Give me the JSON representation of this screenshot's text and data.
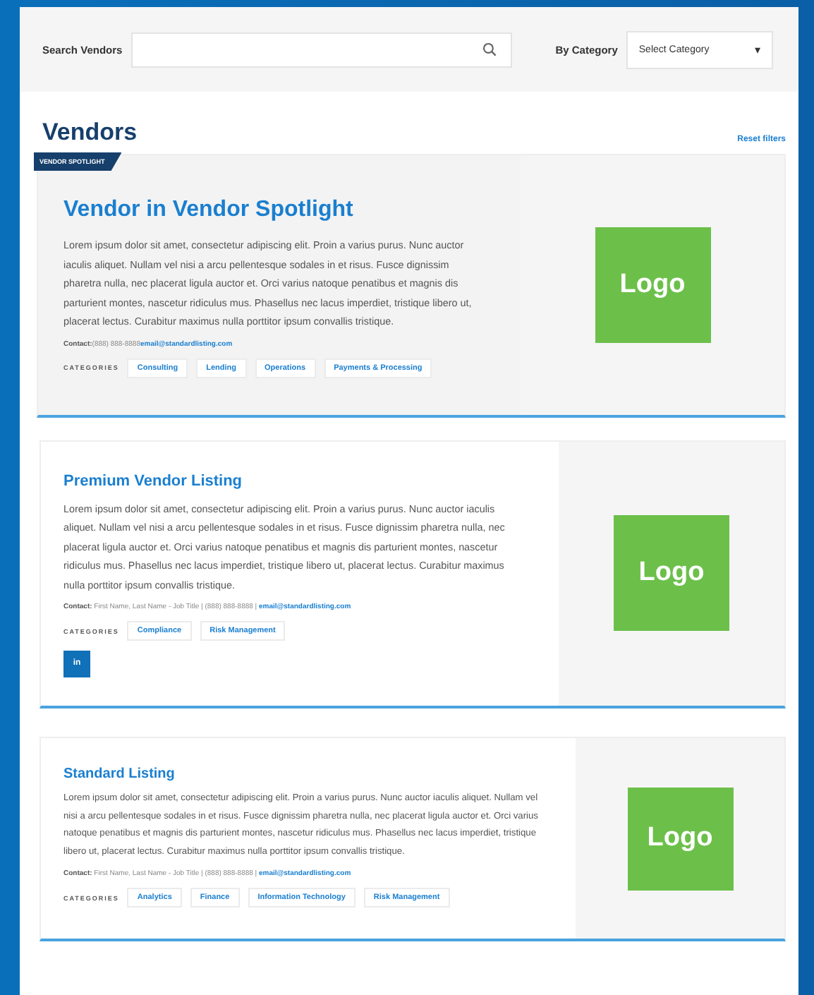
{
  "filters": {
    "search_label": "Search Vendors",
    "category_label": "By Category",
    "category_value": "Select Category",
    "category_caret": "▾"
  },
  "heading": "Vendors",
  "reset_link": "Reset filters",
  "listings": [
    {
      "kind": "spotlight",
      "badge": "VENDOR SPOTLIGHT",
      "title": "Vendor in Vendor Spotlight",
      "description": "Lorem ipsum dolor sit amet, consectetur adipiscing elit. Proin a varius purus. Nunc auctor iaculis aliquet. Nullam vel nisi a arcu pellentesque sodales in et risus. Fusce dignissim pharetra nulla, nec placerat ligula auctor et. Orci varius natoque penatibus et magnis dis parturient montes, nascetur ridiculus mus. Phasellus nec lacus imperdiet, tristique libero ut, placerat lectus. Curabitur maximus nulla porttitor ipsum convallis tristique.",
      "contact_label": "Contact:",
      "contact_details": "(888) 888-8888",
      "email": "email@standardlisting.com",
      "categories_label": "CATEGORIES",
      "categories": [
        "Consulting",
        "Lending",
        "Operations",
        "Payments & Processing"
      ],
      "logo": "Logo"
    },
    {
      "kind": "premium",
      "title": "Premium Vendor Listing",
      "description": "Lorem ipsum dolor sit amet, consectetur adipiscing elit. Proin a varius purus. Nunc auctor iaculis aliquet. Nullam vel nisi a arcu pellentesque sodales in et risus. Fusce dignissim pharetra nulla, nec placerat ligula auctor et. Orci varius natoque penatibus et magnis dis parturient montes, nascetur ridiculus mus. Phasellus nec lacus imperdiet, tristique libero ut, placerat lectus. Curabitur maximus nulla porttitor ipsum convallis tristique.",
      "contact_label": "Contact:",
      "contact_details": " First Name, Last Name - Job Title | (888) 888-8888 | ",
      "email": "email@standardlisting.com",
      "categories_label": "CATEGORIES",
      "categories": [
        "Compliance",
        "Risk Management"
      ],
      "social": "in",
      "logo": "Logo"
    },
    {
      "kind": "standard",
      "title": "Standard Listing",
      "description": "Lorem ipsum dolor sit amet, consectetur adipiscing elit. Proin a varius purus. Nunc auctor iaculis aliquet. Nullam vel nisi a arcu pellentesque sodales in et risus. Fusce dignissim pharetra nulla, nec placerat ligula auctor et. Orci varius natoque penatibus et magnis dis parturient montes, nascetur ridiculus mus. Phasellus nec lacus imperdiet, tristique libero ut, placerat lectus. Curabitur maximus nulla porttitor ipsum convallis tristique.",
      "contact_label": "Contact:",
      "contact_details": " First Name, Last Name - Job Title | (888) 888-8888 | ",
      "email": "email@standardlisting.com",
      "categories_label": "CATEGORIES",
      "categories": [
        "Analytics",
        "Finance",
        "Information Technology",
        "Risk Management"
      ],
      "logo": "Logo"
    }
  ]
}
